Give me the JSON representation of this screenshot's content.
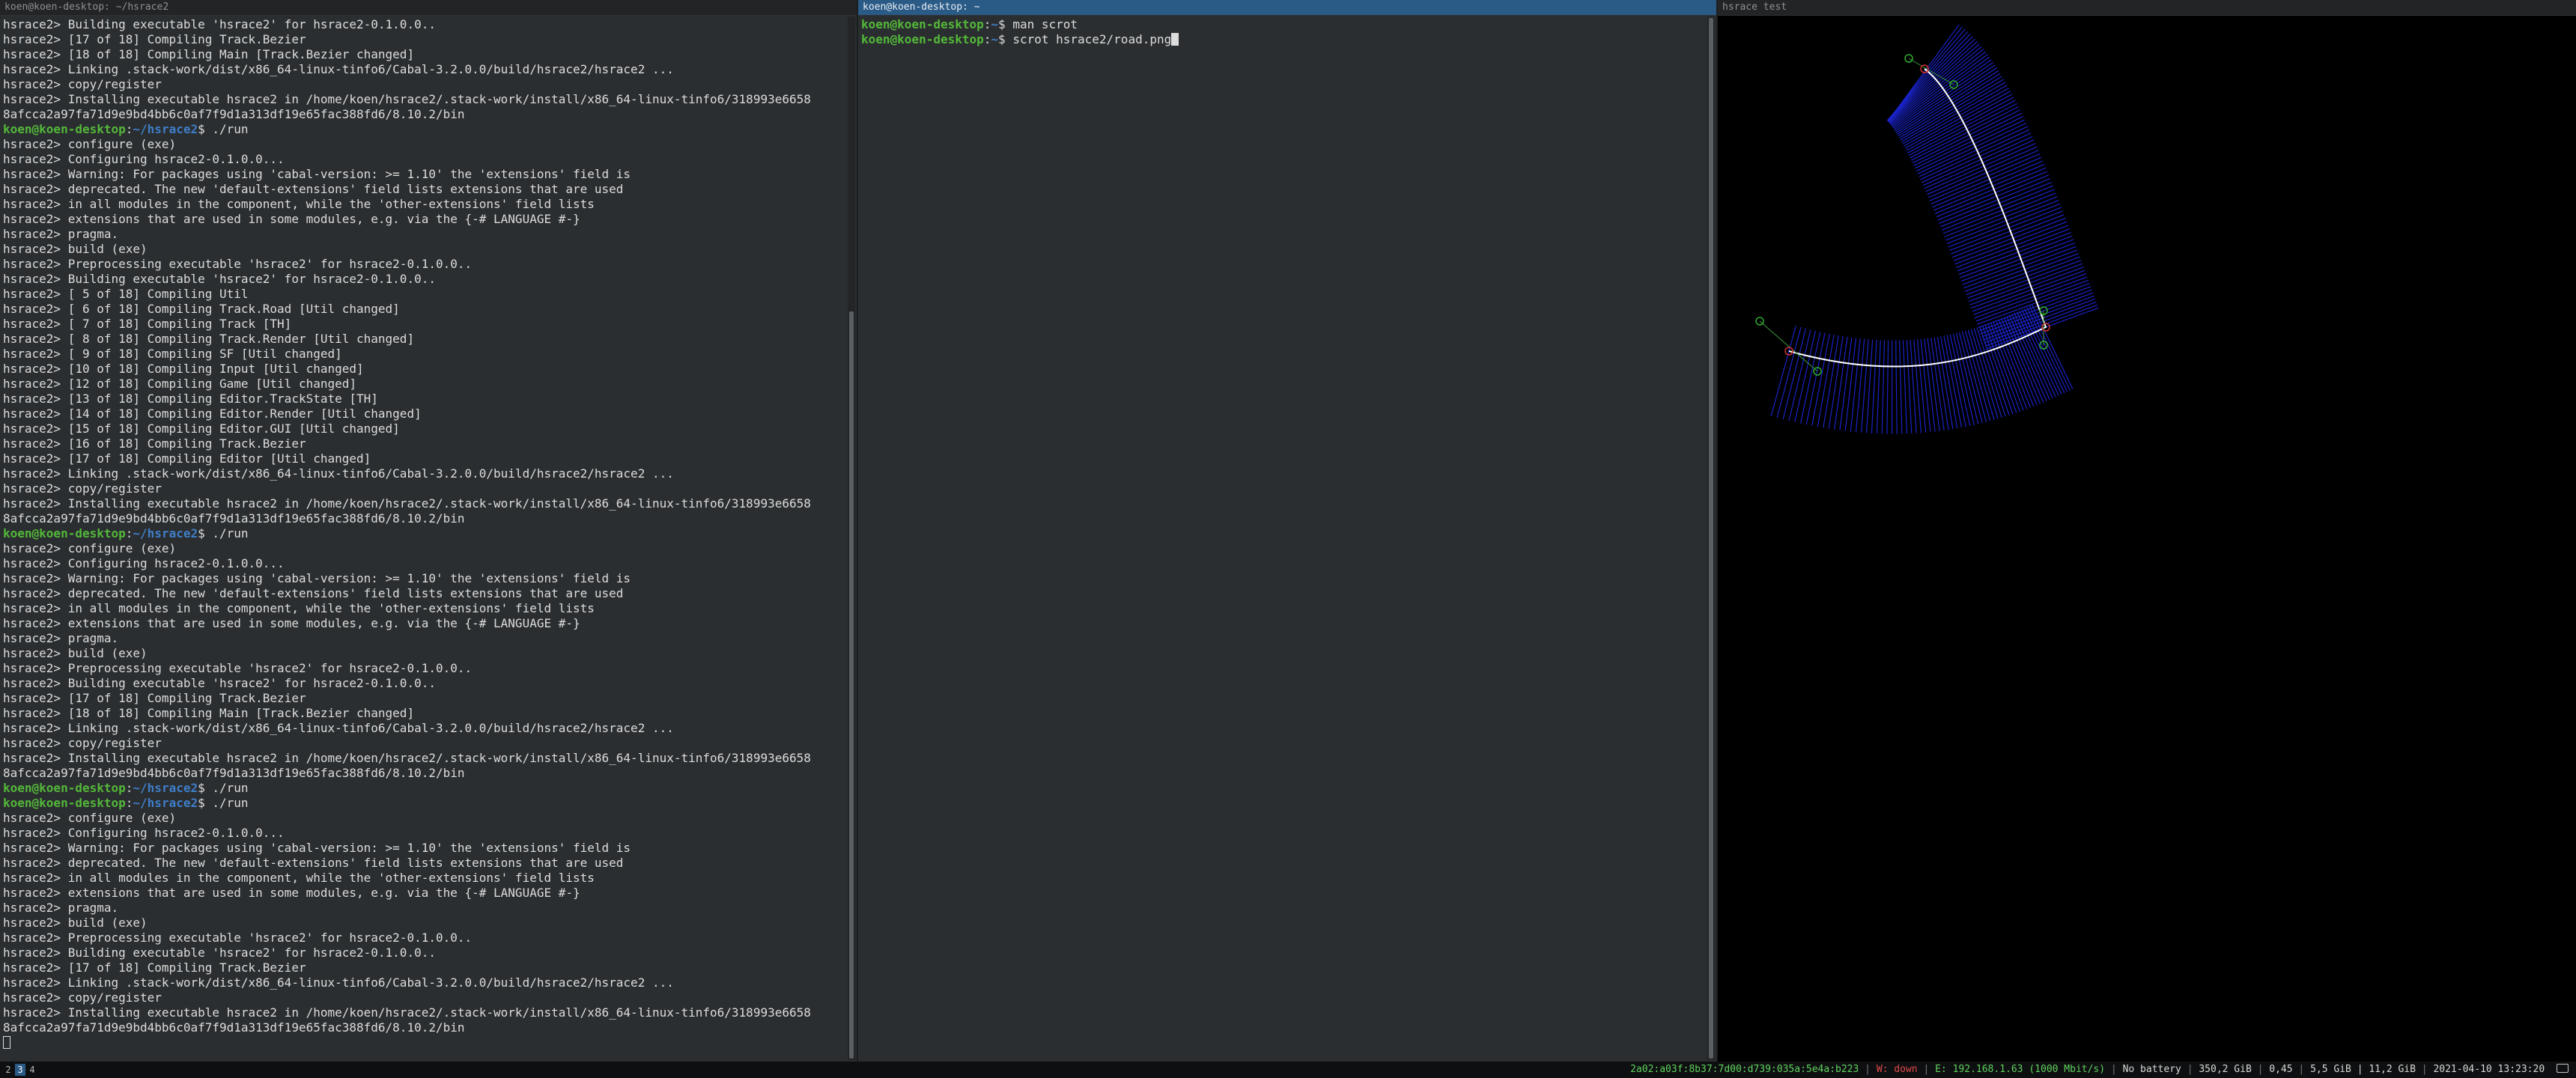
{
  "panes": {
    "left": {
      "title": "koen@koen-desktop: ~/hsrace2",
      "lines": [
        "hsrace2> Building executable 'hsrace2' for hsrace2-0.1.0.0..",
        "hsrace2> [17 of 18] Compiling Track.Bezier",
        "hsrace2> [18 of 18] Compiling Main [Track.Bezier changed]",
        "hsrace2> Linking .stack-work/dist/x86_64-linux-tinfo6/Cabal-3.2.0.0/build/hsrace2/hsrace2 ...",
        "hsrace2> copy/register",
        "hsrace2> Installing executable hsrace2 in /home/koen/hsrace2/.stack-work/install/x86_64-linux-tinfo6/318993e6658",
        "8afcca2a97fa71d9e9bd4bb6c0af7f9d1a313df19e65fac388fd6/8.10.2/bin",
        {
          "user": "koen@koen-desktop",
          "path": "~/hsrace2",
          "cmd": "./run"
        },
        "hsrace2> configure (exe)",
        "hsrace2> Configuring hsrace2-0.1.0.0...",
        "hsrace2> Warning: For packages using 'cabal-version: >= 1.10' the 'extensions' field is",
        "hsrace2> deprecated. The new 'default-extensions' field lists extensions that are used",
        "hsrace2> in all modules in the component, while the 'other-extensions' field lists",
        "hsrace2> extensions that are used in some modules, e.g. via the {-# LANGUAGE #-}",
        "hsrace2> pragma.",
        "hsrace2> build (exe)",
        "hsrace2> Preprocessing executable 'hsrace2' for hsrace2-0.1.0.0..",
        "hsrace2> Building executable 'hsrace2' for hsrace2-0.1.0.0..",
        "hsrace2> [ 5 of 18] Compiling Util",
        "hsrace2> [ 6 of 18] Compiling Track.Road [Util changed]",
        "hsrace2> [ 7 of 18] Compiling Track [TH]",
        "hsrace2> [ 8 of 18] Compiling Track.Render [Util changed]",
        "hsrace2> [ 9 of 18] Compiling SF [Util changed]",
        "hsrace2> [10 of 18] Compiling Input [Util changed]",
        "hsrace2> [12 of 18] Compiling Game [Util changed]",
        "hsrace2> [13 of 18] Compiling Editor.TrackState [TH]",
        "hsrace2> [14 of 18] Compiling Editor.Render [Util changed]",
        "hsrace2> [15 of 18] Compiling Editor.GUI [Util changed]",
        "hsrace2> [16 of 18] Compiling Track.Bezier",
        "hsrace2> [17 of 18] Compiling Editor [Util changed]",
        "hsrace2> Linking .stack-work/dist/x86_64-linux-tinfo6/Cabal-3.2.0.0/build/hsrace2/hsrace2 ...",
        "hsrace2> copy/register",
        "hsrace2> Installing executable hsrace2 in /home/koen/hsrace2/.stack-work/install/x86_64-linux-tinfo6/318993e6658",
        "8afcca2a97fa71d9e9bd4bb6c0af7f9d1a313df19e65fac388fd6/8.10.2/bin",
        {
          "user": "koen@koen-desktop",
          "path": "~/hsrace2",
          "cmd": "./run"
        },
        "hsrace2> configure (exe)",
        "hsrace2> Configuring hsrace2-0.1.0.0...",
        "hsrace2> Warning: For packages using 'cabal-version: >= 1.10' the 'extensions' field is",
        "hsrace2> deprecated. The new 'default-extensions' field lists extensions that are used",
        "hsrace2> in all modules in the component, while the 'other-extensions' field lists",
        "hsrace2> extensions that are used in some modules, e.g. via the {-# LANGUAGE #-}",
        "hsrace2> pragma.",
        "hsrace2> build (exe)",
        "hsrace2> Preprocessing executable 'hsrace2' for hsrace2-0.1.0.0..",
        "hsrace2> Building executable 'hsrace2' for hsrace2-0.1.0.0..",
        "hsrace2> [17 of 18] Compiling Track.Bezier",
        "hsrace2> [18 of 18] Compiling Main [Track.Bezier changed]",
        "hsrace2> Linking .stack-work/dist/x86_64-linux-tinfo6/Cabal-3.2.0.0/build/hsrace2/hsrace2 ...",
        "hsrace2> copy/register",
        "hsrace2> Installing executable hsrace2 in /home/koen/hsrace2/.stack-work/install/x86_64-linux-tinfo6/318993e6658",
        "8afcca2a97fa71d9e9bd4bb6c0af7f9d1a313df19e65fac388fd6/8.10.2/bin",
        {
          "user": "koen@koen-desktop",
          "path": "~/hsrace2",
          "cmd": "./run"
        },
        {
          "user": "koen@koen-desktop",
          "path": "~/hsrace2",
          "cmd": "./run"
        },
        "hsrace2> configure (exe)",
        "hsrace2> Configuring hsrace2-0.1.0.0...",
        "hsrace2> Warning: For packages using 'cabal-version: >= 1.10' the 'extensions' field is",
        "hsrace2> deprecated. The new 'default-extensions' field lists extensions that are used",
        "hsrace2> in all modules in the component, while the 'other-extensions' field lists",
        "hsrace2> extensions that are used in some modules, e.g. via the {-# LANGUAGE #-}",
        "hsrace2> pragma.",
        "hsrace2> build (exe)",
        "hsrace2> Preprocessing executable 'hsrace2' for hsrace2-0.1.0.0..",
        "hsrace2> Building executable 'hsrace2' for hsrace2-0.1.0.0..",
        "hsrace2> [17 of 18] Compiling Track.Bezier",
        "hsrace2> Linking .stack-work/dist/x86_64-linux-tinfo6/Cabal-3.2.0.0/build/hsrace2/hsrace2 ...",
        "hsrace2> copy/register",
        "hsrace2> Installing executable hsrace2 in /home/koen/hsrace2/.stack-work/install/x86_64-linux-tinfo6/318993e6658",
        "8afcca2a97fa71d9e9bd4bb6c0af7f9d1a313df19e65fac388fd6/8.10.2/bin"
      ]
    },
    "middle": {
      "title": "koen@koen-desktop: ~",
      "lines": [
        {
          "user": "koen@koen-desktop",
          "path": "~",
          "cmd": "man scrot"
        },
        {
          "user": "koen@koen-desktop",
          "path": "~",
          "cmd": "scrot hsrace2/road.png"
        }
      ]
    },
    "right": {
      "title": "hsrace test"
    }
  },
  "statusbar": {
    "workspaces": [
      {
        "label": "2",
        "active": false
      },
      {
        "label": "3",
        "active": true
      },
      {
        "label": "4",
        "active": false
      }
    ],
    "ipv6": "2a02:a03f:8b37:7d00:d739:035a:5e4a:b223",
    "wlan": "W: down",
    "eth": "E: 192.168.1.63 (1000 Mbit/s)",
    "battery": "No battery",
    "disk": "350,2 GiB",
    "load": "0,45",
    "memory": "5,5 GiB | 11,2 GiB",
    "datetime": "2021-04-10 13:23:20",
    "colors": {
      "good": "#5fd35f",
      "bad": "#e04a4a",
      "active_ws": "#2a5a86"
    },
    "icons": [
      "monitor-icon"
    ]
  }
}
